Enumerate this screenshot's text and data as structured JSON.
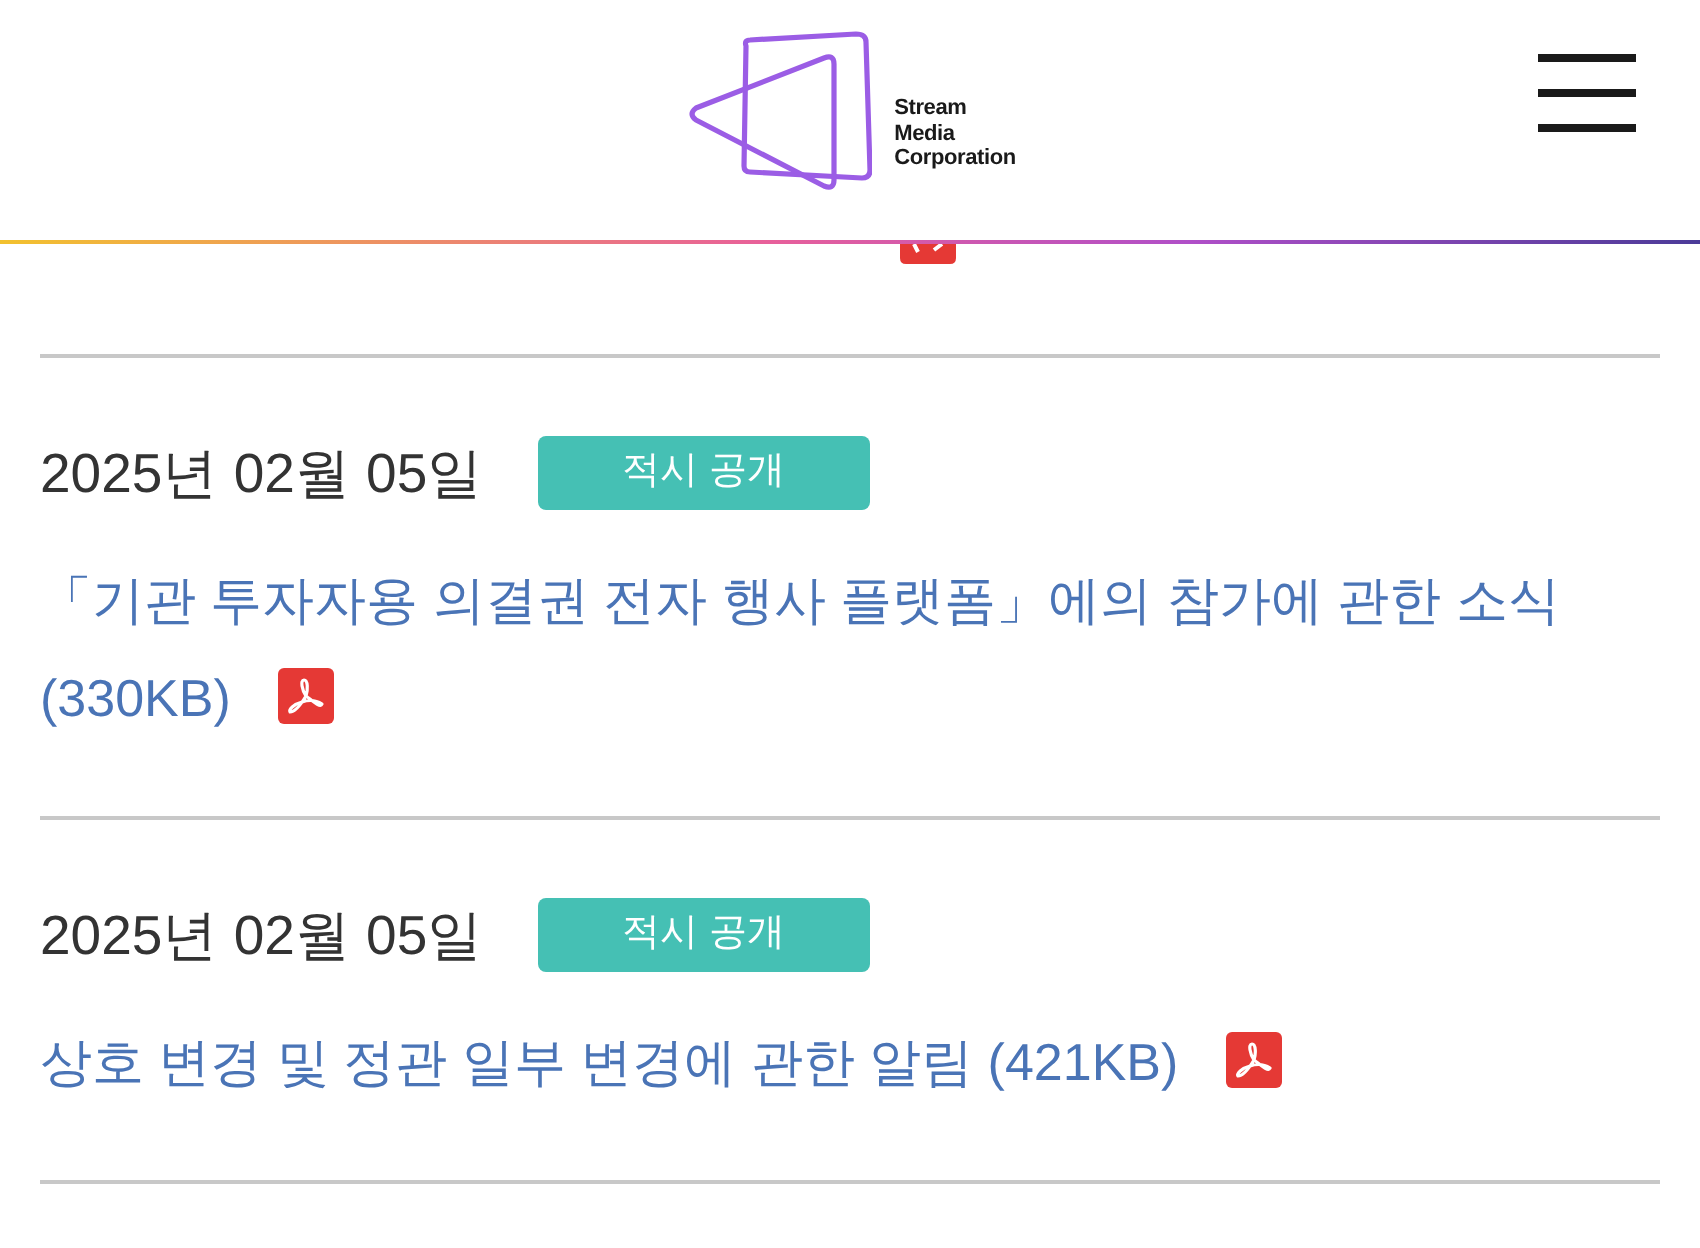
{
  "header": {
    "logo_text": [
      "Stream",
      "Media",
      "Corporation"
    ]
  },
  "notices": [
    {
      "date": "2025년 02월 05일",
      "badge": "적시 공개",
      "title": "「기관 투자자용 의결권 전자 행사 플랫폼」에의 참가에 관한 소식 (330KB)"
    },
    {
      "date": "2025년 02월 05일",
      "badge": "적시 공개",
      "title": "상호 변경 및 정관 일부 변경에 관한 알림 (421KB)"
    }
  ]
}
